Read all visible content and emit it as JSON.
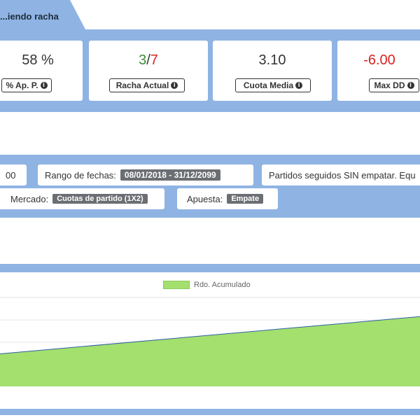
{
  "tab": {
    "title": "...iendo racha"
  },
  "stats": [
    {
      "value": "58 %",
      "label": "% Ap. P."
    },
    {
      "value_green": "3",
      "value_sep": "/",
      "value_red": "7",
      "label": "Racha Actual"
    },
    {
      "value": "3.10",
      "label": "Cuota Media"
    },
    {
      "value": "-6.00",
      "label": "Max DD"
    }
  ],
  "filters": {
    "partial_value": "00",
    "date_range_label": "Rango de fechas:",
    "date_range_value": "08/01/2018 - 31/12/2099",
    "matches_text": "Partidos seguidos SIN empatar. Equ",
    "market_label": "Mercado:",
    "market_value": "Cuotas de partido (1X2)",
    "bet_label": "Apuesta:",
    "bet_value": "Empate"
  },
  "chart_data": {
    "type": "area",
    "series": [
      {
        "name": "Rdo. Acumulado",
        "color": "#a3e06e",
        "start": 0.35,
        "end": 0.75
      }
    ],
    "legend": "top-center",
    "grid": true
  },
  "colors": {
    "panel": "#8fb4e3",
    "positive": "#3d8b37",
    "negative": "#d9231f",
    "area": "#a3e06e"
  }
}
